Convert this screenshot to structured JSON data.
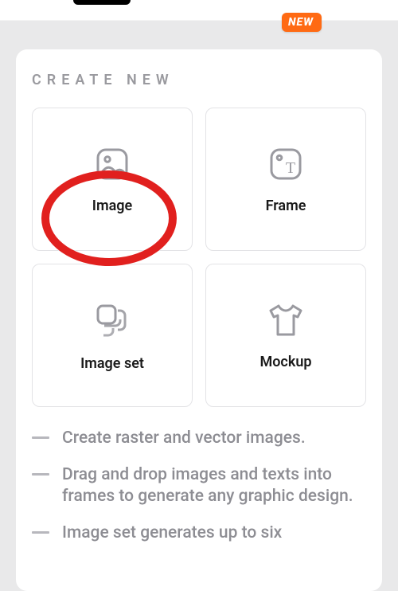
{
  "badge": {
    "label": "NEW"
  },
  "section": {
    "title": "CREATE NEW"
  },
  "tiles": {
    "image": {
      "label": "Image"
    },
    "frame": {
      "label": "Frame"
    },
    "imageset": {
      "label": "Image set"
    },
    "mockup": {
      "label": "Mockup"
    }
  },
  "bullets": {
    "b0": "Create raster and vector images.",
    "b1": "Drag and drop images and texts into frames to generate any graphic design.",
    "b2": "Image set generates up to six"
  },
  "colors": {
    "badge_bg": "#ff6a13",
    "annotation_ring": "#e1201e",
    "muted_text": "#8d8d93"
  }
}
